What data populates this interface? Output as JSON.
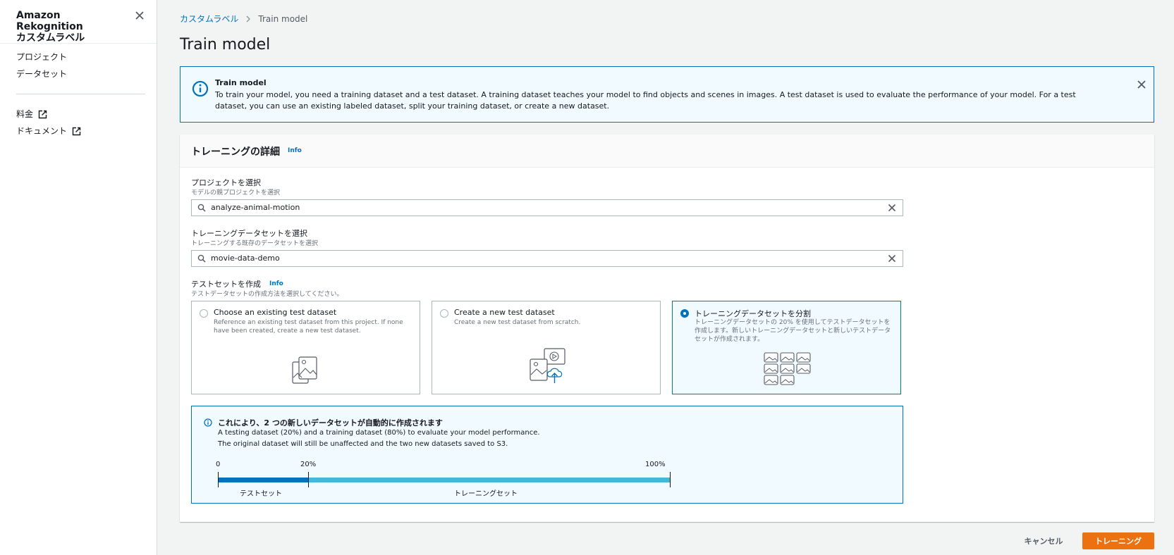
{
  "sidebar": {
    "title_line1": "Amazon Rekognition",
    "title_line2": "カスタムラベル",
    "items": [
      {
        "label": "プロジェクト"
      },
      {
        "label": "データセット"
      },
      {
        "label": "料金"
      },
      {
        "label": "ドキュメント"
      }
    ]
  },
  "breadcrumb": {
    "parent": "カスタムラベル",
    "current": "Train model"
  },
  "page": {
    "title": "Train model"
  },
  "flash": {
    "title": "Train model",
    "body": "To train your model, you need a training dataset and a test dataset. A training dataset teaches your model to find objects and scenes in images. A test dataset is used to evaluate the performance of your model. For a test dataset, you can use an existing labeled dataset, split your training dataset, or create a new dataset."
  },
  "training": {
    "header": "トレーニングの詳細",
    "info": "Info",
    "project": {
      "label": "プロジェクトを選択",
      "description": "モデルの親プロジェクトを選択",
      "value": "analyze-animal-motion"
    },
    "dataset": {
      "label": "トレーニングデータセットを選択",
      "description": "トレーニングする既存のデータセットを選択",
      "value": "movie-data-demo"
    },
    "testset": {
      "label": "テストセットを作成",
      "info": "Info",
      "description": "テストデータセットの作成方法を選択してください。",
      "options": [
        {
          "title": "Choose an existing test dataset",
          "description": "Reference an existing test dataset from this project. If none have been created, create a new test dataset."
        },
        {
          "title": "Create a new test dataset",
          "description": "Create a new test dataset from scratch."
        },
        {
          "title": "トレーニングデータセットを分割",
          "description": "トレーニングデータセットの 20% を使用してテストデータセットを作成します。新しいトレーニングデータセットと新しいテストデータセットが作成されます。"
        }
      ],
      "selected_index": 2
    },
    "split": {
      "title": "これにより、2 つの新しいデータセットが自動的に作成されます",
      "line1": "A testing dataset (20%) and a training dataset (80%) to evaluate your model performance.",
      "line2": "The original dataset will still be unaffected and the two new datasets saved to S3.",
      "tick_start": "0",
      "tick_mid": "20%",
      "tick_end": "100%",
      "test_label": "テストセット",
      "train_label": "トレーニングセット",
      "test_percent": 20
    }
  },
  "actions": {
    "cancel": "キャンセル",
    "train": "トレーニング"
  },
  "colors": {
    "accent": "#0073bb",
    "primary_button": "#ec7211",
    "info_bg": "#f1faff",
    "bar_train": "#44b9d6"
  }
}
